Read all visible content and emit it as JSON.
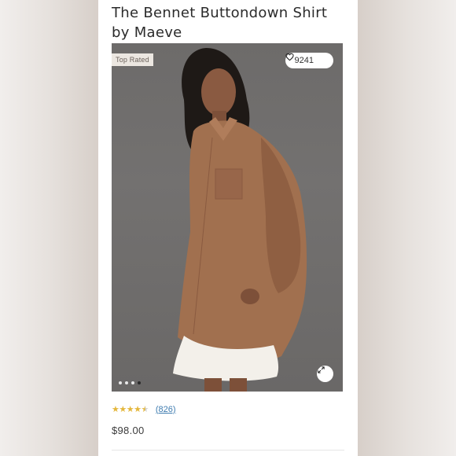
{
  "product": {
    "title": "The Bennet Buttondown Shirt by Maeve",
    "badge": "Top Rated",
    "likes": "9241",
    "rating": 4.5,
    "reviews": "(826)",
    "price": "$98.00"
  },
  "gallery": {
    "image_count": 4,
    "active_index": 3
  },
  "icons": {
    "like": "heart-icon",
    "expand": "expand-icon",
    "rating": "star-icon"
  },
  "colors": {
    "star": "#e4b73c",
    "link": "#3f7cb0",
    "background": "#6d6b6a"
  }
}
